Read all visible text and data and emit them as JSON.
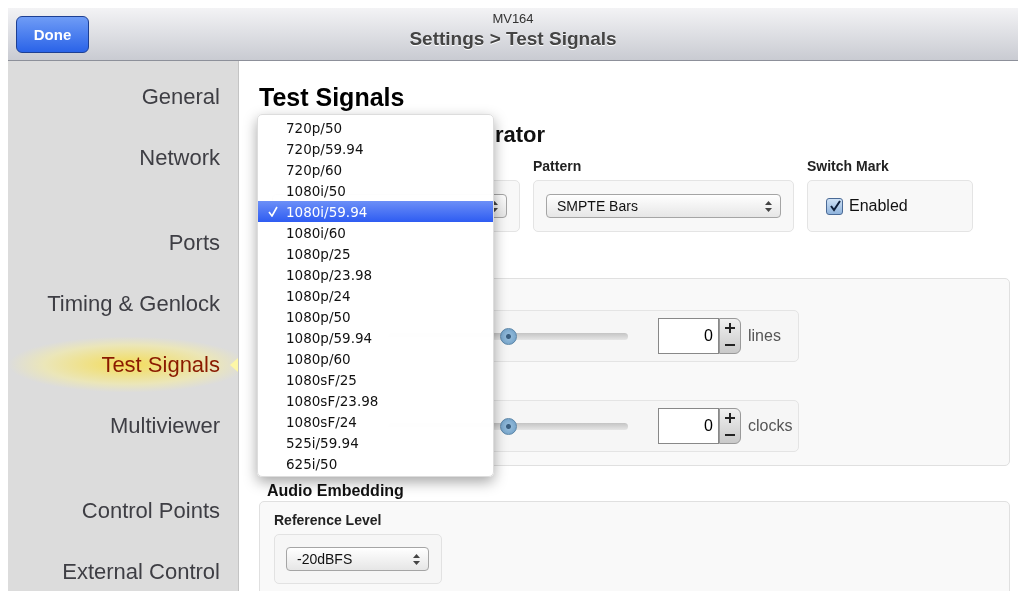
{
  "header": {
    "done_button": "Done",
    "device": "MV164",
    "title": "Settings > Test Signals"
  },
  "sidebar": {
    "groups": [
      {
        "items": [
          {
            "label": "General",
            "selected": false
          },
          {
            "label": "Network",
            "selected": false
          }
        ]
      },
      {
        "items": [
          {
            "label": "Ports",
            "selected": false
          },
          {
            "label": "Timing & Genlock",
            "selected": false
          },
          {
            "label": "Test Signals",
            "selected": true
          },
          {
            "label": "Multiviewer",
            "selected": false
          }
        ]
      },
      {
        "items": [
          {
            "label": "Control Points",
            "selected": false
          },
          {
            "label": "External Control",
            "selected": false
          }
        ]
      }
    ]
  },
  "page_title": "Test Signals",
  "generator": {
    "heading_visible_part": "rator",
    "pattern": {
      "label": "Pattern",
      "value": "SMPTE Bars"
    },
    "switch_mark": {
      "label": "Switch Mark",
      "checkbox_label": "Enabled",
      "checked": true
    },
    "timing": [
      {
        "level": 0.5,
        "value": "0",
        "unit": "lines"
      },
      {
        "level": 0.5,
        "value": "0",
        "unit": "clocks"
      }
    ]
  },
  "format_menu": {
    "items": [
      {
        "label": "720p/50",
        "selected": false
      },
      {
        "label": "720p/59.94",
        "selected": false
      },
      {
        "label": "720p/60",
        "selected": false
      },
      {
        "label": "1080i/50",
        "selected": false
      },
      {
        "label": "1080i/59.94",
        "selected": true
      },
      {
        "label": "1080i/60",
        "selected": false
      },
      {
        "label": "1080p/25",
        "selected": false
      },
      {
        "label": "1080p/23.98",
        "selected": false
      },
      {
        "label": "1080p/24",
        "selected": false
      },
      {
        "label": "1080p/50",
        "selected": false
      },
      {
        "label": "1080p/59.94",
        "selected": false
      },
      {
        "label": "1080p/60",
        "selected": false
      },
      {
        "label": "1080sF/25",
        "selected": false
      },
      {
        "label": "1080sF/23.98",
        "selected": false
      },
      {
        "label": "1080sF/24",
        "selected": false
      },
      {
        "label": "525i/59.94",
        "selected": false
      },
      {
        "label": "625i/50",
        "selected": false
      }
    ]
  },
  "audio": {
    "heading": "Audio Embedding",
    "reference_level": {
      "label": "Reference Level",
      "value": "-20dBFS"
    }
  }
}
